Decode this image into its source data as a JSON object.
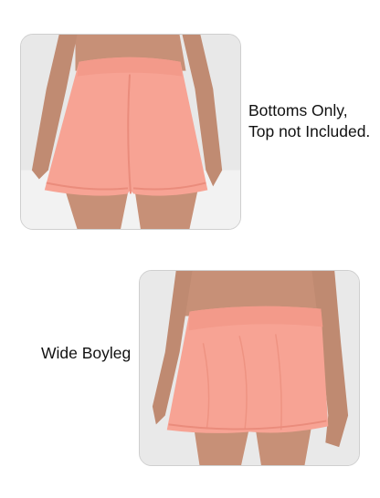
{
  "panels": [
    {
      "caption_lines": [
        "Bottoms Only,",
        "Top not Included."
      ],
      "photo_subject": "back-view-shorts-photo"
    },
    {
      "caption_lines": [
        "Wide Boyleg"
      ],
      "photo_subject": "side-view-shorts-photo"
    }
  ],
  "colors": {
    "shorts": "#f7a394",
    "shorts_shadow": "#ef8f80",
    "skin": "#c79077",
    "background_wall": "#e9e9e9",
    "caption_text": "#111111"
  }
}
